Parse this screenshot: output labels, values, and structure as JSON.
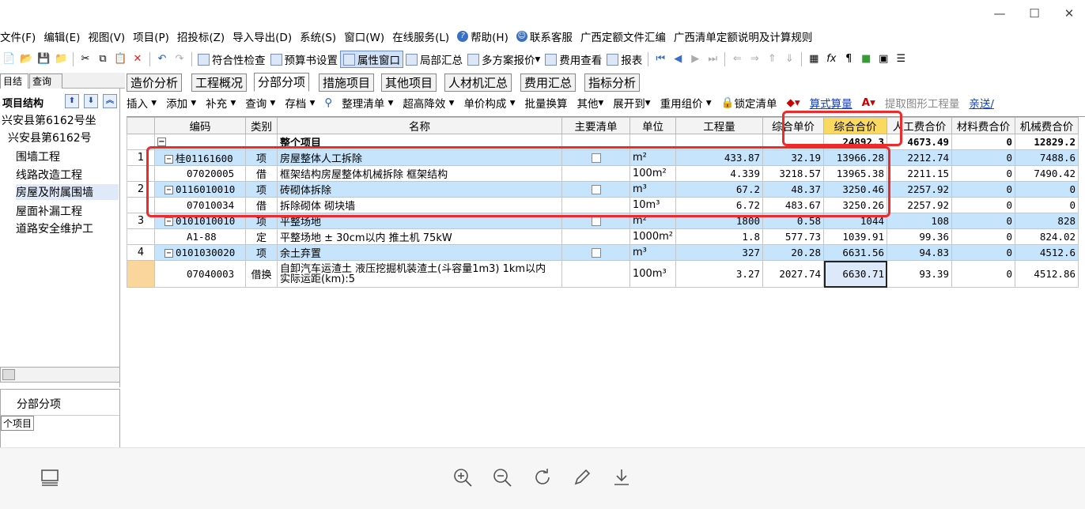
{
  "window": {
    "min": "—",
    "max": "☐",
    "close": "✕"
  },
  "menu": [
    "文件(F)",
    "编辑(E)",
    "视图(V)",
    "项目(P)",
    "招投标(Z)",
    "导入导出(D)",
    "系统(S)",
    "窗口(W)",
    "在线服务(L)",
    "帮助(H)",
    "联系客服",
    "广西定额文件汇编",
    "广西清单定额说明及计算规则"
  ],
  "toolbar": {
    "check": "符合性检查",
    "budget": "预算书设置",
    "props": "属性窗口",
    "local": "局部汇总",
    "multi": "多方案报价",
    "fee": "费用查看",
    "report": "报表"
  },
  "left": {
    "tab_structure": "目结构",
    "tab_query": "查询",
    "header": "项目结构",
    "tree": [
      "兴安县第6162号坐",
      "兴安县第6162号",
      "围墙工程",
      "线路改造工程",
      "房屋及附属围墙",
      "屋面补漏工程",
      "道路安全维护工"
    ],
    "lower_title": "分部分项",
    "lower_item": "个项目"
  },
  "tabs": [
    "造价分析",
    "工程概况",
    "分部分项",
    "措施项目",
    "其他项目",
    "人材机汇总",
    "费用汇总",
    "指标分析"
  ],
  "subtoolbar": [
    "插入",
    "添加",
    "补充",
    "查询",
    "存档",
    "整理清单",
    "超高降效",
    "单价构成",
    "批量换算",
    "其他",
    "展开到",
    "重用组价",
    "锁定清单",
    "算式算量",
    "提取图形工程量",
    "亲送/"
  ],
  "grid": {
    "columns": [
      "编码",
      "类别",
      "名称",
      "主要清单",
      "单位",
      "工程量",
      "综合单价",
      "综合合价",
      "人工费合价",
      "材料费合价",
      "机械费合价"
    ],
    "total": {
      "name": "整个项目",
      "zhhj": "24892.3",
      "rg": "4673.49",
      "cl": "0",
      "jx": "12829.2"
    },
    "rows": [
      {
        "type": "item",
        "no": "1",
        "code": "桂01161600",
        "cat": "项",
        "name": "房屋整体人工拆除",
        "unit": "m²",
        "qty": "433.87",
        "price": "32.19",
        "total": "13966.28",
        "rg": "2212.74",
        "cl": "0",
        "jx": "7488.6"
      },
      {
        "type": "sub",
        "no": "",
        "code": "07020005",
        "cat": "借",
        "name": "框架结构房屋整体机械拆除 框架结构",
        "unit": "100m²",
        "qty": "4.339",
        "price": "3218.57",
        "total": "13965.38",
        "rg": "2211.15",
        "cl": "0",
        "jx": "7490.42"
      },
      {
        "type": "item",
        "no": "2",
        "code": "0116010010",
        "cat": "项",
        "name": "砖砌体拆除",
        "unit": "m³",
        "qty": "67.2",
        "price": "48.37",
        "total": "3250.46",
        "rg": "2257.92",
        "cl": "0",
        "jx": "0"
      },
      {
        "type": "sub",
        "no": "",
        "code": "07010034",
        "cat": "借",
        "name": "拆除砌体 砌块墙",
        "unit": "10m³",
        "qty": "6.72",
        "price": "483.67",
        "total": "3250.26",
        "rg": "2257.92",
        "cl": "0",
        "jx": "0"
      },
      {
        "type": "item",
        "no": "3",
        "code": "0101010010",
        "cat": "项",
        "name": "平整场地",
        "unit": "m²",
        "qty": "1800",
        "price": "0.58",
        "total": "1044",
        "rg": "108",
        "cl": "0",
        "jx": "828"
      },
      {
        "type": "sub",
        "no": "",
        "code": "A1-88",
        "cat": "定",
        "name": "平整场地 ± 30cm以内 推土机 75kW",
        "unit": "1000m²",
        "qty": "1.8",
        "price": "577.73",
        "total": "1039.91",
        "rg": "99.36",
        "cl": "0",
        "jx": "824.02"
      },
      {
        "type": "item",
        "no": "4",
        "code": "0101030020",
        "cat": "项",
        "name": "余土弃置",
        "unit": "m³",
        "qty": "327",
        "price": "20.28",
        "total": "6631.56",
        "rg": "94.83",
        "cl": "0",
        "jx": "4512.6"
      },
      {
        "type": "sub",
        "no": "",
        "code": "07040003",
        "cat": "借换",
        "name": "自卸汽车运渣土 液压挖掘机装渣土(斗容量1m3) 1km以内  实际运距(km):5",
        "unit": "100m³",
        "qty": "3.27",
        "price": "2027.74",
        "total": "6630.71",
        "rg": "93.39",
        "cl": "0",
        "jx": "4512.86"
      }
    ]
  },
  "colors": {
    "item_row": "#c6e4fb",
    "highlight_header": "#f9d95f",
    "annotation": "#ee2a2a"
  }
}
